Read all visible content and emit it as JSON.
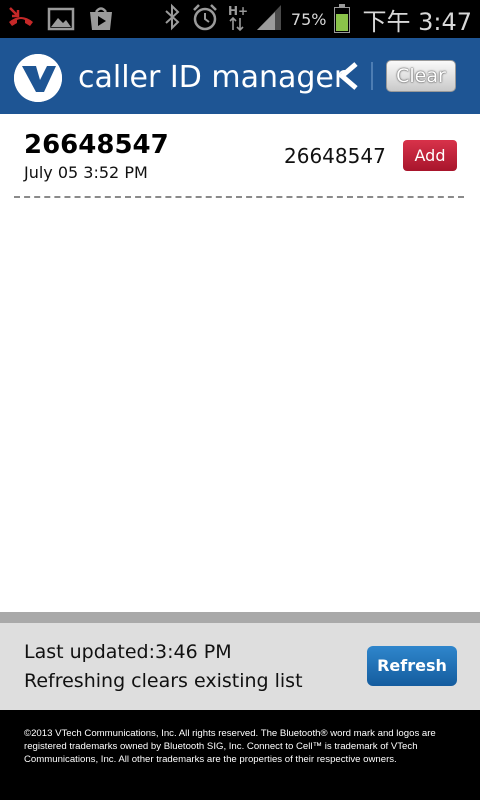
{
  "status_bar": {
    "icons": [
      "missed-call-icon",
      "image-icon",
      "play-store-icon",
      "bluetooth-icon",
      "alarm-icon",
      "hplus-data-icon",
      "signal-icon",
      "battery-icon"
    ],
    "battery": "75%",
    "time": "下午 3:47"
  },
  "header": {
    "title": "caller ID manager",
    "clear_label": "Clear",
    "accent_color": "#1e5594"
  },
  "calls": [
    {
      "name": "26648547",
      "time": "July 05 3:52 PM",
      "number": "26648547",
      "add_label": "Add"
    }
  ],
  "footer": {
    "last_updated": "Last updated:3:46 PM",
    "note": "Refreshing clears existing list",
    "refresh_label": "Refresh"
  },
  "copyright": "©2013 VTech Communications, Inc. All rights reserved. The Bluetooth® word mark and logos are registered trademarks owned by Bluetooth SIG, Inc. Connect to Cell™ is trademark of VTech Communications, Inc. All other trademarks are the properties of their respective owners."
}
